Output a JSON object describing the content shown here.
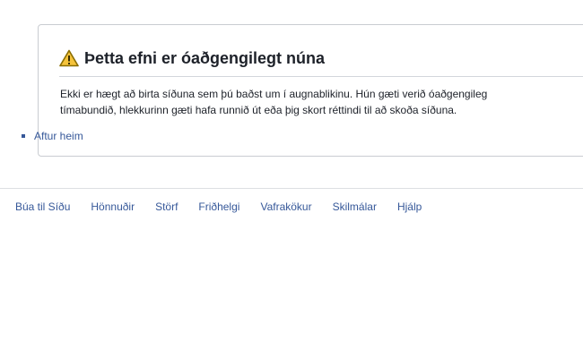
{
  "error": {
    "icon": "warning-icon",
    "icon_color": "#f5c33b",
    "title": "Þetta efni er óaðgengilegt núna",
    "message_line1": "Ekki er hægt að birta síðuna sem þú baðst um í augnablikinu. Hún gæti verið óaðgengileg",
    "message_line2": "tímabundið, hlekkurinn gæti hafa runnið út eða þig skort réttindi til að skoða síðuna.",
    "back_link": "Aftur heim"
  },
  "footer": {
    "links": [
      "Búa til Síðu",
      "Hönnuðir",
      "Störf",
      "Friðhelgi",
      "Vafrakökur",
      "Skilmálar",
      "Hjálp"
    ]
  },
  "colors": {
    "link": "#365899",
    "text": "#1d2129",
    "border": "#c9ccd1"
  }
}
